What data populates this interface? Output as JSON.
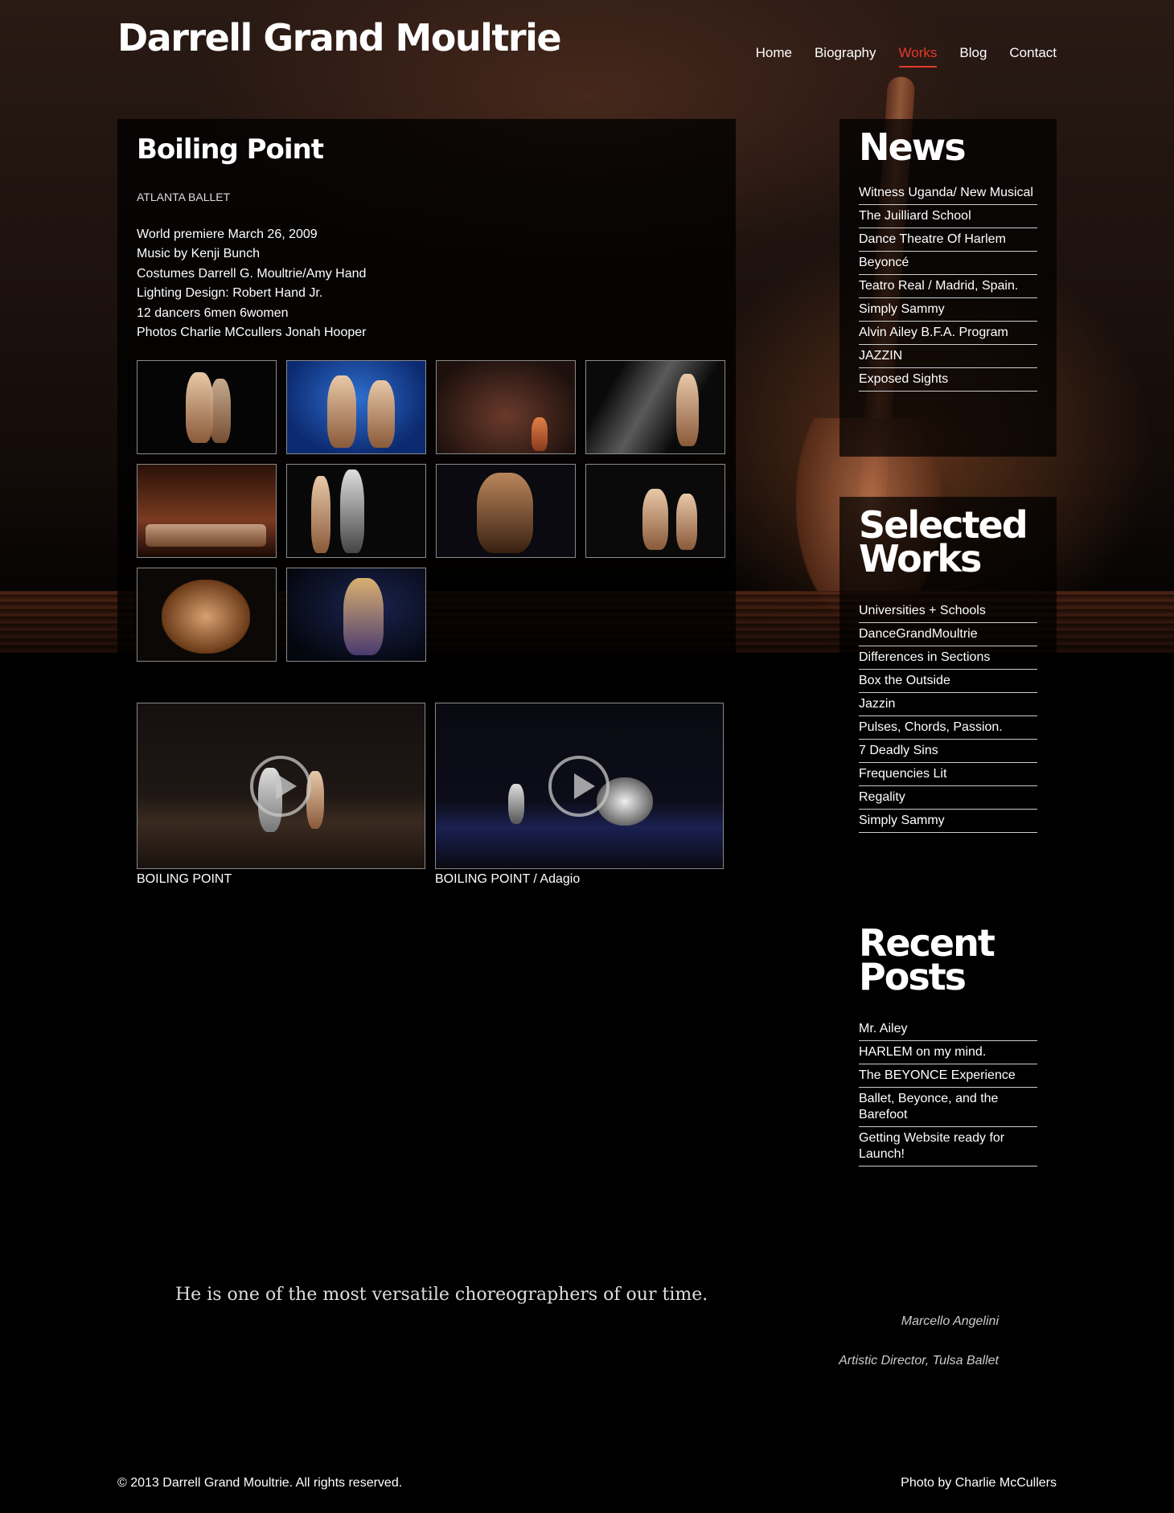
{
  "site": {
    "title": "Darrell Grand Moultrie"
  },
  "nav": {
    "items": [
      {
        "label": "Home"
      },
      {
        "label": "Biography"
      },
      {
        "label": "Works"
      },
      {
        "label": "Blog"
      },
      {
        "label": "Contact"
      }
    ],
    "active": "Works",
    "active_color": "#e43a2d"
  },
  "work": {
    "title": "Boiling Point",
    "company": "ATLANTA BALLET",
    "credits": [
      "World premiere March 26, 2009",
      "Music by Kenji Bunch",
      "Costumes Darrell G. Moultrie/Amy Hand",
      "Lighting Design: Robert Hand Jr.",
      "12 dancers 6men 6women",
      "Photos Charlie MCcullers Jonah Hooper"
    ],
    "photo_count": 10,
    "videos": [
      {
        "caption": "BOILING POINT"
      },
      {
        "caption": "BOILING POINT / Adagio"
      }
    ]
  },
  "sidebar": {
    "news": {
      "title": "News",
      "items": [
        "Witness Uganda/ New Musical",
        "The Juilliard School",
        "Dance Theatre Of Harlem",
        "Beyoncé",
        "Teatro Real / Madrid, Spain.",
        "Simply Sammy",
        "Alvin Ailey B.F.A. Program",
        "JAZZIN",
        "Exposed Sights"
      ]
    },
    "selected_works": {
      "title_line1": "Selected",
      "title_line2": "Works",
      "items": [
        "Universities + Schools",
        "DanceGrandMoultrie",
        "Differences in Sections",
        "Box the Outside",
        "Jazzin",
        "Pulses, Chords, Passion.",
        "7 Deadly Sins",
        "Frequencies Lit",
        "Regality",
        "Simply Sammy"
      ]
    },
    "recent_posts": {
      "title_line1": "Recent",
      "title_line2": "Posts",
      "items": [
        "Mr. Ailey",
        "HARLEM on my mind.",
        "The BEYONCE Experience",
        "Ballet, Beyonce, and the Barefoot",
        "Getting Website ready for Launch!"
      ]
    }
  },
  "quote": {
    "text": "He is one of the most versatile choreographers of our time.",
    "author": "Marcello Angelini",
    "role": "Artistic Director, Tulsa Ballet"
  },
  "footer": {
    "copyright": "© 2013 Darrell Grand Moultrie. All rights reserved.",
    "photo_credit": "Photo by Charlie McCullers"
  }
}
